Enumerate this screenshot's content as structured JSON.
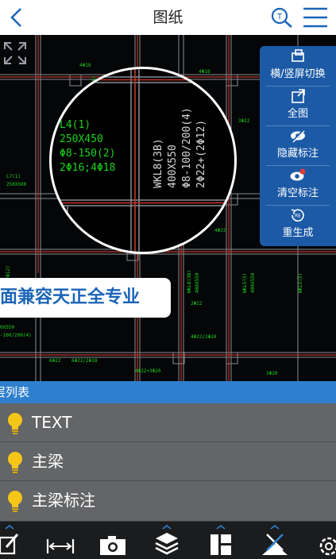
{
  "header": {
    "title": "图纸"
  },
  "drawing": {
    "zoom_text_left": [
      "L4(1)",
      "250X450",
      "Φ8-150(2)",
      "2Φ16;4Φ18"
    ],
    "zoom_text_right": [
      "WKL8(3B)",
      "400X550",
      "Φ8-100/200(4)",
      "2Φ22+(2Φ12)"
    ],
    "banner": "面兼容天正全专业"
  },
  "side_menu": [
    {
      "label": "横/竖屏切换",
      "icon": "rotate-screen-icon"
    },
    {
      "label": "全图",
      "icon": "fit-view-icon"
    },
    {
      "label": "隐藏标注",
      "icon": "eye-hidden-icon"
    },
    {
      "label": "清空标注",
      "icon": "eye-clear-icon"
    },
    {
      "label": "重生成",
      "icon": "regenerate-icon"
    }
  ],
  "layers": {
    "header": "层列表",
    "items": [
      {
        "name": "TEXT"
      },
      {
        "name": "主梁"
      },
      {
        "name": "主梁标注"
      }
    ]
  },
  "toolbar": [
    {
      "icon": "edit-icon"
    },
    {
      "icon": "measure-icon"
    },
    {
      "icon": "camera-icon"
    },
    {
      "icon": "layers-icon"
    },
    {
      "icon": "layout-icon"
    },
    {
      "icon": "cad-tool-icon"
    },
    {
      "icon": "settings-icon"
    }
  ],
  "colors": {
    "accent": "#1c5aa6",
    "green_text": "#1bd31b",
    "bulb": "#f5c518"
  }
}
